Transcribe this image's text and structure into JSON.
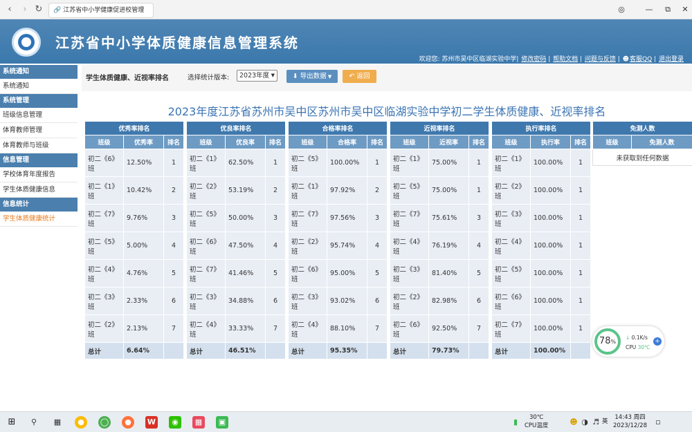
{
  "browser": {
    "tab_title": "江苏省中小学健康促进校管理"
  },
  "header": {
    "title": "江苏省中小学体质健康信息管理系统",
    "welcome": "欢迎您: 苏州市吴中区临湖实验中学|",
    "links": [
      "修改密码",
      "帮助文档",
      "问题与反馈",
      "客服QQ",
      "退出登录"
    ]
  },
  "sidebar": [
    {
      "type": "header",
      "label": "系统通知"
    },
    {
      "type": "item",
      "label": "系统通知"
    },
    {
      "type": "header",
      "label": "系统管理"
    },
    {
      "type": "item",
      "label": "班级信息管理"
    },
    {
      "type": "item",
      "label": "体育教师管理"
    },
    {
      "type": "item",
      "label": "体育教师与班级"
    },
    {
      "type": "header",
      "label": "信息管理"
    },
    {
      "type": "item",
      "label": "学校体育年度报告"
    },
    {
      "type": "item",
      "label": "学生体质健康信息"
    },
    {
      "type": "header",
      "label": "信息统计"
    },
    {
      "type": "item",
      "label": "学生体质健康统计",
      "active": true
    }
  ],
  "toolbar": {
    "page_title": "学生体质健康、近视率排名",
    "version_label": "选择统计版本:",
    "version_value": "2023年度",
    "export_label": "导出数据",
    "back_label": "返回"
  },
  "report_title": "2023年度江苏省苏州市吴中区苏州市吴中区临湖实验中学初二学生体质健康、近视率排名",
  "tables": [
    {
      "title": "优秀率排名",
      "cols": [
        "班级",
        "优秀率",
        "排名"
      ],
      "rows": [
        [
          "初二《6》班",
          "12.50%",
          "1"
        ],
        [
          "初二《1》班",
          "10.42%",
          "2"
        ],
        [
          "初二《7》班",
          "9.76%",
          "3"
        ],
        [
          "初二《5》班",
          "5.00%",
          "4"
        ],
        [
          "初二《4》班",
          "4.76%",
          "5"
        ],
        [
          "初二《3》班",
          "2.33%",
          "6"
        ],
        [
          "初二《2》班",
          "2.13%",
          "7"
        ]
      ],
      "total_label": "总计",
      "total_value": "6.64%"
    },
    {
      "title": "优良率排名",
      "cols": [
        "班级",
        "优良率",
        "排名"
      ],
      "rows": [
        [
          "初二《1》班",
          "62.50%",
          "1"
        ],
        [
          "初二《2》班",
          "53.19%",
          "2"
        ],
        [
          "初二《5》班",
          "50.00%",
          "3"
        ],
        [
          "初二《6》班",
          "47.50%",
          "4"
        ],
        [
          "初二《7》班",
          "41.46%",
          "5"
        ],
        [
          "初二《3》班",
          "34.88%",
          "6"
        ],
        [
          "初二《4》班",
          "33.33%",
          "7"
        ]
      ],
      "total_label": "总计",
      "total_value": "46.51%"
    },
    {
      "title": "合格率排名",
      "cols": [
        "班级",
        "合格率",
        "排名"
      ],
      "rows": [
        [
          "初二《5》班",
          "100.00%",
          "1"
        ],
        [
          "初二《1》班",
          "97.92%",
          "2"
        ],
        [
          "初二《7》班",
          "97.56%",
          "3"
        ],
        [
          "初二《2》班",
          "95.74%",
          "4"
        ],
        [
          "初二《6》班",
          "95.00%",
          "5"
        ],
        [
          "初二《3》班",
          "93.02%",
          "6"
        ],
        [
          "初二《4》班",
          "88.10%",
          "7"
        ]
      ],
      "total_label": "总计",
      "total_value": "95.35%"
    },
    {
      "title": "近视率排名",
      "cols": [
        "班级",
        "近视率",
        "排名"
      ],
      "rows": [
        [
          "初二《1》班",
          "75.00%",
          "1"
        ],
        [
          "初二《5》班",
          "75.00%",
          "1"
        ],
        [
          "初二《7》班",
          "75.61%",
          "3"
        ],
        [
          "初二《4》班",
          "76.19%",
          "4"
        ],
        [
          "初二《3》班",
          "81.40%",
          "5"
        ],
        [
          "初二《2》班",
          "82.98%",
          "6"
        ],
        [
          "初二《6》班",
          "92.50%",
          "7"
        ]
      ],
      "total_label": "总计",
      "total_value": "79.73%"
    },
    {
      "title": "执行率排名",
      "cols": [
        "班级",
        "执行率",
        "排名"
      ],
      "rows": [
        [
          "初二《1》班",
          "100.00%",
          "1"
        ],
        [
          "初二《2》班",
          "100.00%",
          "1"
        ],
        [
          "初二《3》班",
          "100.00%",
          "1"
        ],
        [
          "初二《4》班",
          "100.00%",
          "1"
        ],
        [
          "初二《5》班",
          "100.00%",
          "1"
        ],
        [
          "初二《6》班",
          "100.00%",
          "1"
        ],
        [
          "初二《7》班",
          "100.00%",
          "1"
        ]
      ],
      "total_label": "总计",
      "total_value": "100.00%"
    }
  ],
  "exempt": {
    "title": "免测人数",
    "cols": [
      "班级",
      "免测人数"
    ],
    "empty_text": "未获取到任何数据"
  },
  "widget": {
    "percent": "78",
    "percent_unit": "%",
    "net": "0.1K/s",
    "cpu_label": "CPU",
    "cpu_temp": "30℃"
  },
  "taskbar": {
    "temp": "30℃",
    "temp_label": "CPU温度",
    "lang": "英",
    "time": "14:43 周四",
    "date": "2023/12/28"
  }
}
